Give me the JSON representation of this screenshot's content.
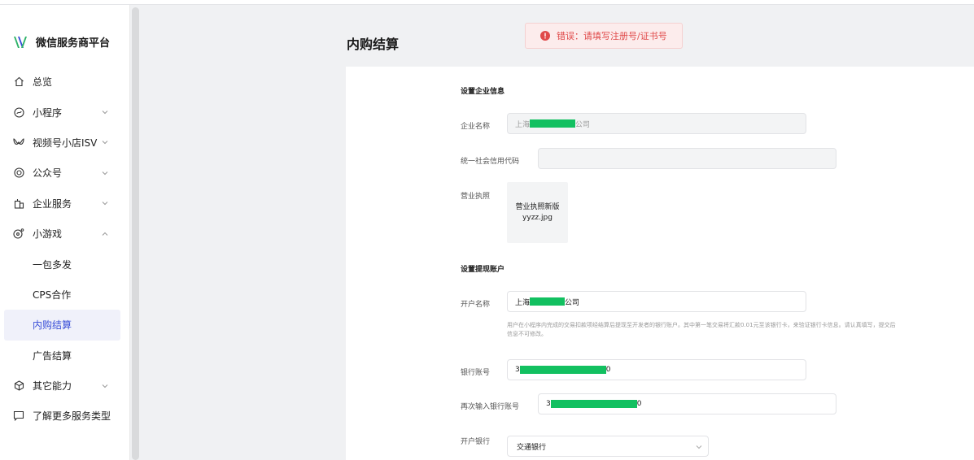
{
  "brand": {
    "name": "微信服务商平台"
  },
  "sidebar": {
    "items": [
      {
        "label": "总览",
        "icon": "home-icon"
      },
      {
        "label": "小程序",
        "icon": "miniprogram-icon"
      },
      {
        "label": "视频号小店ISV",
        "icon": "channels-icon"
      },
      {
        "label": "公众号",
        "icon": "official-account-icon"
      },
      {
        "label": "企业服务",
        "icon": "enterprise-icon"
      },
      {
        "label": "小游戏",
        "icon": "minigame-icon"
      },
      {
        "label": "一包多发"
      },
      {
        "label": "CPS合作"
      },
      {
        "label": "内购结算"
      },
      {
        "label": "广告结算"
      },
      {
        "label": "其它能力",
        "icon": "cube-icon"
      },
      {
        "label": "了解更多服务类型",
        "icon": "chat-icon"
      }
    ]
  },
  "page": {
    "title": "内购结算"
  },
  "toast": {
    "text": "错误：请填写注册号/证书号",
    "color": "#e04a4a"
  },
  "form": {
    "company_section": "设置企业信息",
    "company_name_label": "企业名称",
    "company_name_prefix": "上海",
    "company_name_suffix": "公司",
    "credit_code_label": "统一社会信用代码",
    "credit_code_value": "",
    "license_label": "营业执照",
    "license_file": "营业执照新版yyzz.jpg",
    "account_section": "设置提现账户",
    "account_name_label": "开户名称",
    "account_name_prefix": "上海",
    "account_name_suffix": "公司",
    "account_hint": "用户在小程序内完成的交易扣款项经结算后提现至开发者的银行账户。其中第一笔交易将汇款0.01元至该银行卡，来验证银行卡信息。请认真填写，提交后信息不可修改。",
    "bank_account_label": "银行账号",
    "bank_account_prefix": "3",
    "bank_account_suffix": "0",
    "bank_account_confirm_label": "再次输入银行账号",
    "bank_account_confirm_prefix": "3",
    "bank_account_confirm_suffix": "0",
    "bank_label": "开户银行",
    "bank_value": "交通银行"
  },
  "colors": {
    "accent": "#3a4fd8",
    "mask": "#12c060",
    "error": "#e04a4a"
  }
}
